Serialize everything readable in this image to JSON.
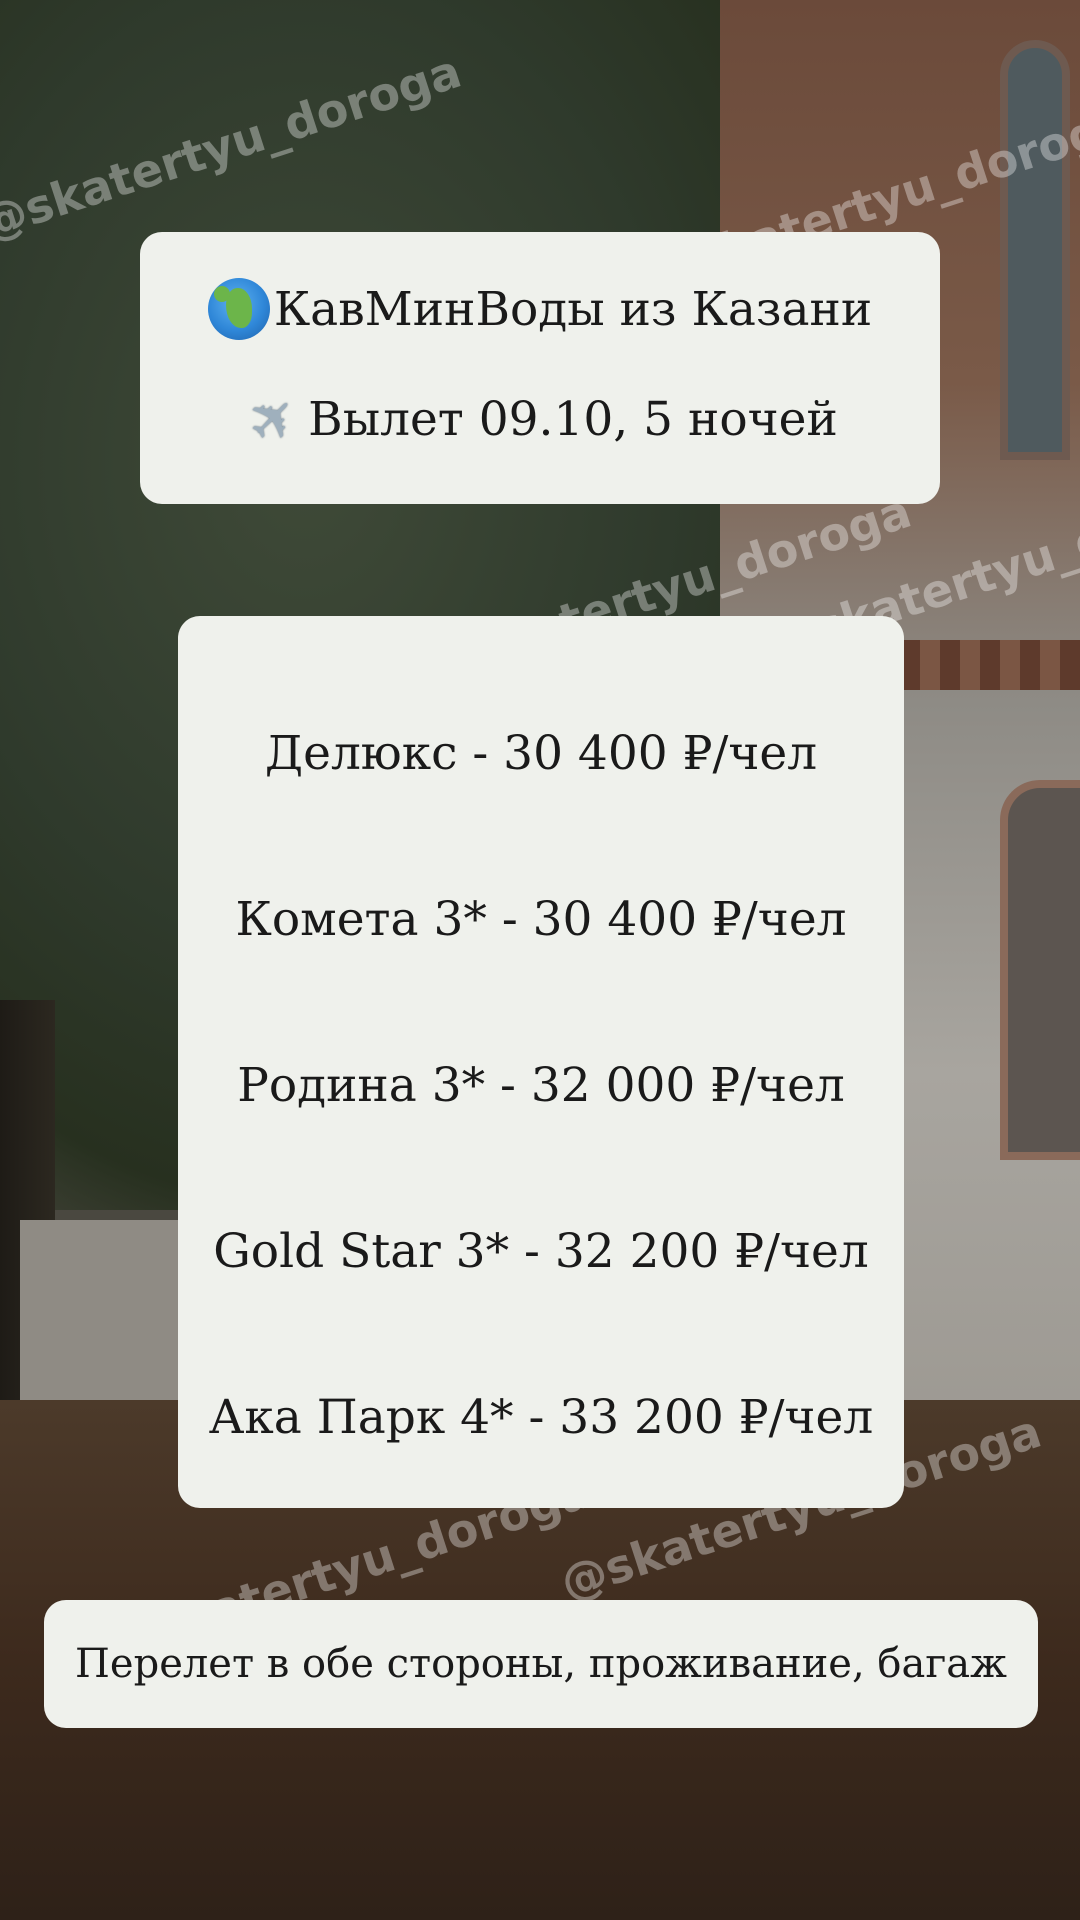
{
  "header": {
    "icon_1": "globe-icon",
    "line_1": "КавМинВоды из Казани",
    "icon_2": "airplane-icon",
    "line_2": "Вылет 09.10, 5 ночей"
  },
  "prices": [
    "Делюкс - 30 400 ₽/чел",
    "Комета 3* - 30 400 ₽/чел",
    "Родина 3* - 32 000 ₽/чел",
    "Gold Star 3* - 32 200 ₽/чел",
    "Ака Парк 4* - 33 200 ₽/чел"
  ],
  "footer": {
    "included": "Перелет в обе стороны, проживание, багаж"
  },
  "watermark": "@skatertyu_doroga",
  "colors": {
    "card_background": "#eff1ec",
    "text": "#1a1a1a"
  }
}
